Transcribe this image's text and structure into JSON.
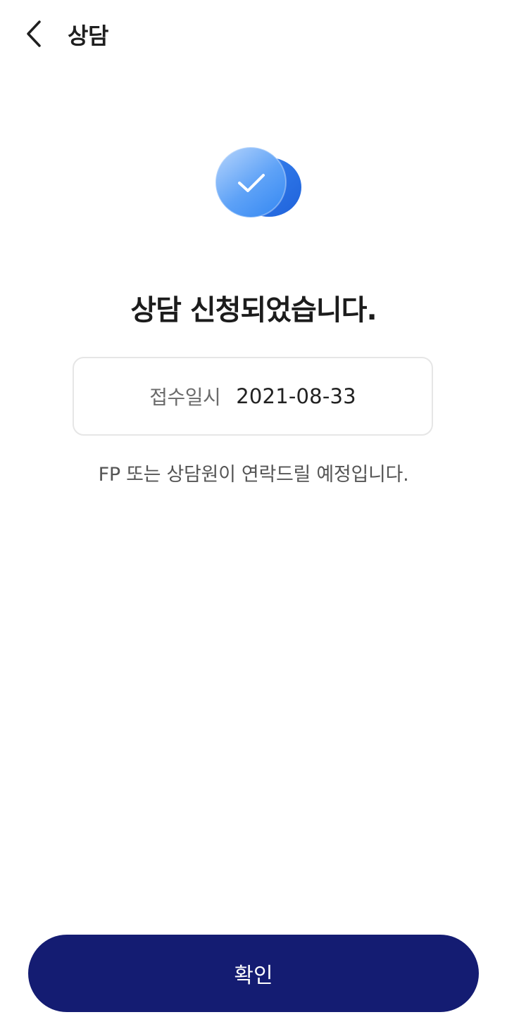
{
  "header": {
    "title": "상담",
    "back_icon": "chevron-left-icon"
  },
  "main": {
    "status_icon": "check-circle-icon",
    "headline": "상담 신청되었습니다.",
    "receipt": {
      "label": "접수일시",
      "value": "2021-08-33"
    },
    "notice": "FP 또는 상담원이 연락드릴 예정입니다."
  },
  "footer": {
    "confirm_label": "확인"
  },
  "colors": {
    "primary": "#141c72",
    "accent_blue": "#3f8ef5",
    "accent_blue_dark": "#2a6fe3"
  }
}
